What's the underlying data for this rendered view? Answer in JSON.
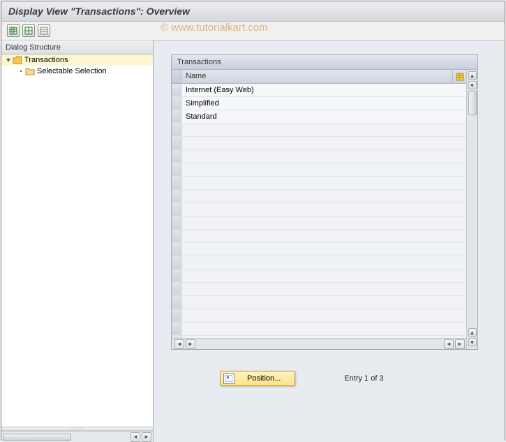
{
  "title": "Display View \"Transactions\": Overview",
  "toolbar": {
    "buttons": [
      "table-icon-1",
      "table-icon-2",
      "table-icon-3"
    ]
  },
  "sidebar": {
    "header": "Dialog Structure",
    "items": [
      {
        "label": "Transactions",
        "expanded": true,
        "selected": true
      },
      {
        "label": "Selectable Selection",
        "child": true
      }
    ]
  },
  "table": {
    "title": "Transactions",
    "column_header": "Name",
    "rows": [
      "Internet (Easy Web)",
      "Simplified",
      "Standard"
    ],
    "empty_rows": 17
  },
  "footer": {
    "position_label": "Position...",
    "entry_text": "Entry 1 of 3"
  },
  "watermark": "© www.tutorialkart.com",
  "colors": {
    "highlight": "#fef6d0",
    "panel_header": "#c8d0de",
    "button_yellow": "#fde38a"
  }
}
